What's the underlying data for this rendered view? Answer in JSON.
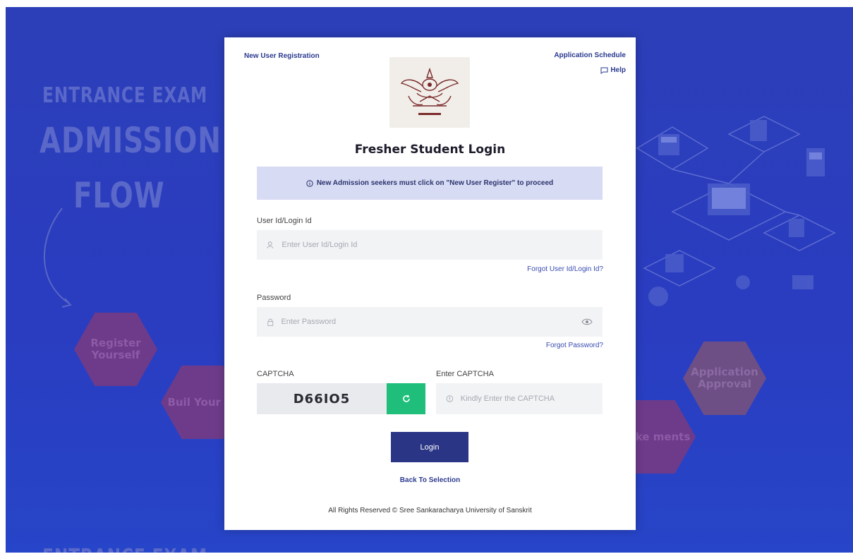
{
  "background": {
    "heading1": "ENTRANCE EXAM",
    "heading2": "ADMISSION",
    "heading3": "FLOW",
    "steps": [
      "Register Yourself",
      "Buil Your Pr",
      "Make ments",
      "Application Approval"
    ],
    "footer_heading": "ENTRANCE EXAM"
  },
  "card": {
    "new_user_link": "New User Registration",
    "schedule_link": "Application Schedule",
    "help_link": "Help",
    "title": "Fresher Student Login",
    "notice": "New Admission seekers must click on \"New User Register\" to proceed",
    "userid": {
      "label": "User Id/Login Id",
      "placeholder": "Enter User Id/Login Id",
      "forgot": "Forgot User Id/Login Id?"
    },
    "password": {
      "label": "Password",
      "placeholder": "Enter Password",
      "forgot": "Forgot Password?"
    },
    "captcha": {
      "label": "CAPTCHA",
      "code": "D66IO5",
      "enter_label": "Enter CAPTCHA",
      "placeholder": "Kindly Enter the CAPTCHA"
    },
    "login_button": "Login",
    "back_link": "Back To Selection",
    "footer": "All Rights Reserved © Sree Sankaracharya University of Sanskrit"
  },
  "colors": {
    "background": "#2c3fb8",
    "primary": "#2b3585",
    "accent_green": "#1fbf7b",
    "notice_bg": "#d7dbf3"
  }
}
